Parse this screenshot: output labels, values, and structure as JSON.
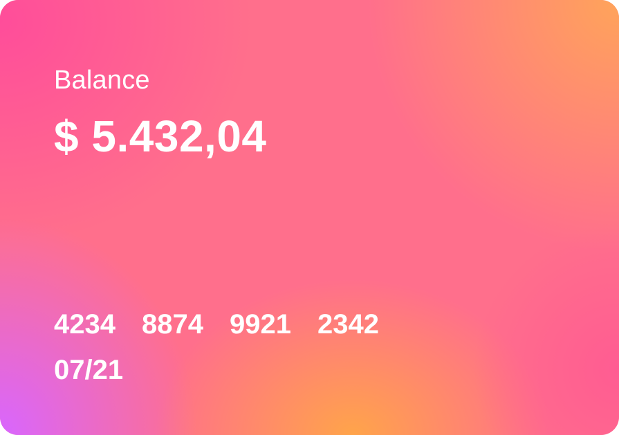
{
  "card": {
    "balance_label": "Balance",
    "balance_amount": "$ 5.432,04",
    "number_groups": [
      "4234",
      "8874",
      "9921",
      "2342"
    ],
    "expiry": "07/21"
  },
  "colors": {
    "pink": "#ff4d9a",
    "orange": "#ffa45a",
    "purple": "#d866ff",
    "text": "#ffffff"
  }
}
